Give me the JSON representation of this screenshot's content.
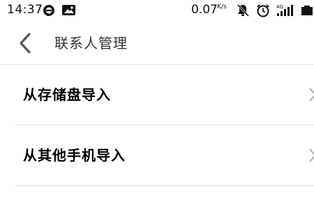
{
  "status_bar": {
    "time": "14:37",
    "speed_value": "0.07",
    "speed_unit": "K/s",
    "network": "4G",
    "icons": [
      "notification-circle-icon",
      "gallery-notification-icon",
      "mute-bell-icon",
      "alarm-icon",
      "signal-icon",
      "battery-icon"
    ]
  },
  "header": {
    "title": "联系人管理",
    "back_icon": "chevron-left-icon"
  },
  "list": {
    "items": [
      {
        "label": "从存储盘导入",
        "icon": "chevron-right-icon"
      },
      {
        "label": "从其他手机导入",
        "icon": "chevron-right-icon"
      }
    ]
  },
  "colors": {
    "background": "#ffffff",
    "text": "#000000",
    "title_text": "#333333",
    "divider": "#dedede"
  }
}
